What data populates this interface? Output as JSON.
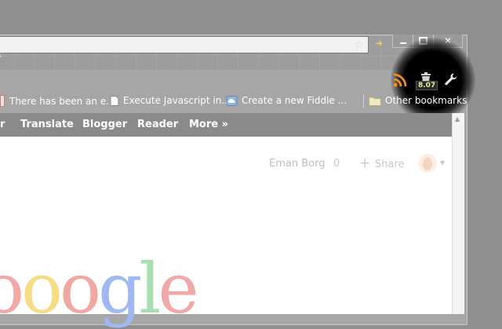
{
  "bookmarks": [
    {
      "label": "There has been an e..."
    },
    {
      "label": "Execute Javascript in..."
    },
    {
      "label": "Create a new Fiddle ..."
    }
  ],
  "other_bookmarks": "Other bookmarks",
  "extension": {
    "badge": "8.07"
  },
  "nav": {
    "partial": "r",
    "items": [
      "Translate",
      "Blogger",
      "Reader",
      "More »"
    ]
  },
  "user": {
    "name": "Eman Borg",
    "notifications": "0",
    "share": "Share"
  },
  "logo_letters": [
    {
      "ch": "o",
      "color": "#f3a8a8"
    },
    {
      "ch": "o",
      "color": "#f6dc84"
    },
    {
      "ch": "o",
      "color": "#f2a8a2"
    },
    {
      "ch": "g",
      "color": "#9fb8f3"
    },
    {
      "ch": "l",
      "color": "#a8ddb0"
    },
    {
      "ch": "e",
      "color": "#f2a8a8"
    }
  ],
  "icons": {
    "star": "bookmark-star-icon",
    "go": "go-arrow-icon",
    "rss": "rss-feed-icon",
    "extension": "trash-extension-icon",
    "wrench": "wrench-menu-icon"
  }
}
